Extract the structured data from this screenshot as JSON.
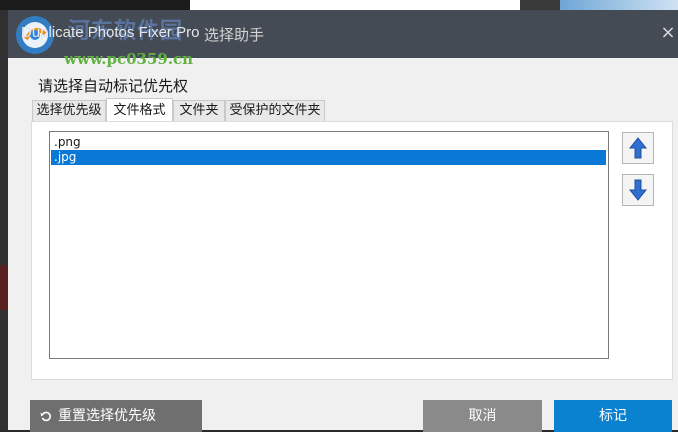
{
  "titlebar": {
    "app_name": "Duplicate Photos Fixer Pro",
    "dialog_title": "选择助手",
    "close_glyph": "×"
  },
  "watermark": {
    "site_name": "河东软件园",
    "url": "www.pc0359.cn"
  },
  "main": {
    "heading": "请选择自动标记优先权",
    "tabs": [
      {
        "label": "选择优先级",
        "active": false
      },
      {
        "label": "文件格式",
        "active": true
      },
      {
        "label": "文件夹",
        "active": false
      },
      {
        "label": "受保护的文件夹",
        "active": false
      }
    ],
    "list": [
      {
        "label": ".png",
        "selected": false
      },
      {
        "label": ".jpg",
        "selected": true
      }
    ]
  },
  "footer": {
    "reset_label": "重置选择优先级",
    "cancel_label": "取消",
    "mark_label": "标记"
  },
  "colors": {
    "accent": "#0b82cf",
    "selection": "#0a78d7",
    "titlebar": "#444b54"
  }
}
